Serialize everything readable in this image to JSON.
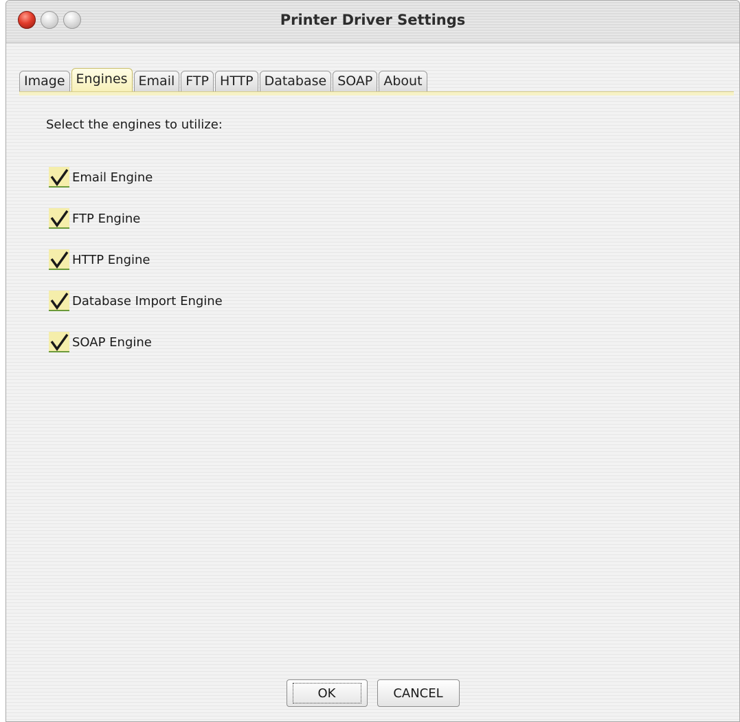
{
  "window": {
    "title": "Printer Driver Settings"
  },
  "tabs": [
    {
      "label": "Image",
      "selected": false
    },
    {
      "label": "Engines",
      "selected": true
    },
    {
      "label": "Email",
      "selected": false
    },
    {
      "label": "FTP",
      "selected": false
    },
    {
      "label": "HTTP",
      "selected": false
    },
    {
      "label": "Database",
      "selected": false
    },
    {
      "label": "SOAP",
      "selected": false
    },
    {
      "label": "About",
      "selected": false
    }
  ],
  "engines_panel": {
    "prompt": "Select the engines to utilize:",
    "options": [
      {
        "label": "Email Engine",
        "checked": true
      },
      {
        "label": "FTP Engine",
        "checked": true
      },
      {
        "label": "HTTP Engine",
        "checked": true
      },
      {
        "label": "Database Import Engine",
        "checked": true
      },
      {
        "label": "SOAP Engine",
        "checked": true
      }
    ]
  },
  "buttons": {
    "ok_label": "OK",
    "cancel_label": "CANCEL"
  },
  "colors": {
    "active_tab": "#f7f0b8",
    "checkbox_fill": "#f5eeab",
    "close_button": "#e23c2b"
  },
  "icons": {
    "close": "close-icon",
    "minimize": "minimize-icon",
    "zoom": "zoom-icon",
    "check": "checkmark-icon"
  }
}
